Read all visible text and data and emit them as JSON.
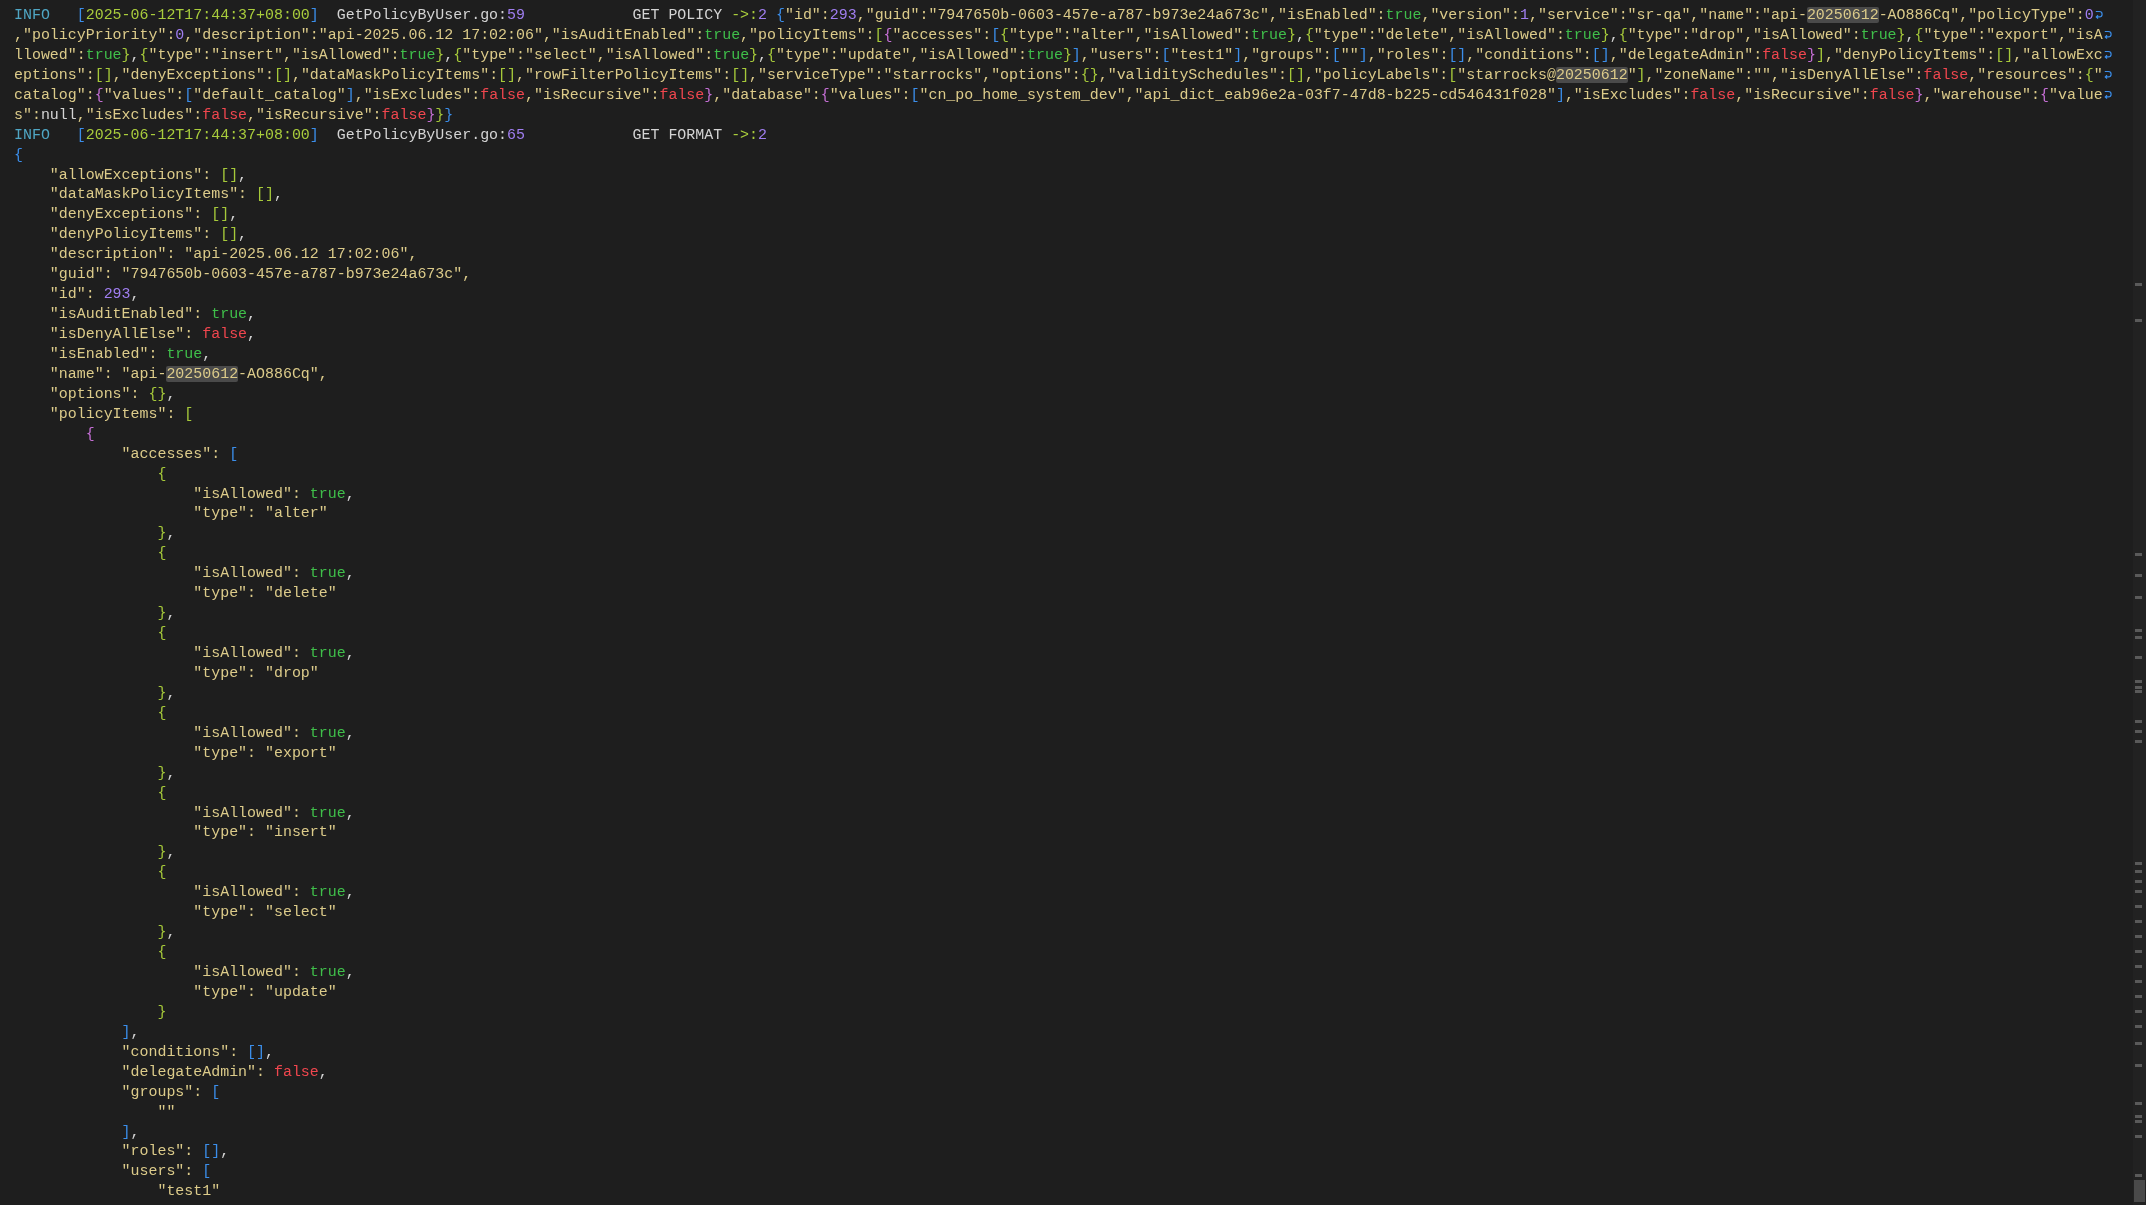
{
  "terminal": {
    "lines": [
      {
        "wrapped": true,
        "tokens": [
          {
            "text": "INFO",
            "kind": "lvl"
          },
          {
            "text": "   [",
            "kind": "b0"
          },
          {
            "text": "2025-06-12T17:44:37+08:00",
            "kind": "ts"
          },
          {
            "text": "]",
            "kind": "b0"
          },
          {
            "text": "  GetPolicyByUser.go:",
            "kind": "p"
          },
          {
            "text": "59",
            "kind": "n"
          },
          {
            "text": "            GET POLICY ",
            "kind": "p"
          },
          {
            "text": "->:",
            "kind": "ts"
          },
          {
            "text": "2",
            "kind": "n"
          },
          {
            "text": " {",
            "kind": "b0"
          },
          {
            "text": "\"id\":",
            "kind": "s"
          },
          {
            "text": "293",
            "kind": "n"
          },
          {
            "text": ",\"guid\":\"7947650b-0603-457e-a787-b973e24a673c\",\"isEnabled\":",
            "kind": "s"
          },
          {
            "text": "true",
            "kind": "t"
          },
          {
            "text": ",\"version\":",
            "kind": "s"
          },
          {
            "text": "1",
            "kind": "n"
          },
          {
            "text": ",\"service\":\"sr-qa\",\"name\":\"api-",
            "kind": "s"
          },
          {
            "text": "20250612",
            "kind": "m"
          },
          {
            "text": "-AO886Cq\",\"policyType\":",
            "kind": "s"
          },
          {
            "text": "0",
            "kind": "n"
          }
        ]
      },
      {
        "wrapped": true,
        "tokens": [
          {
            "text": ",\"policyPriority\":",
            "kind": "s"
          },
          {
            "text": "0",
            "kind": "n"
          },
          {
            "text": ",\"description\":\"api-2025.06.12 17:02:06\",\"isAuditEnabled\":",
            "kind": "s"
          },
          {
            "text": "true",
            "kind": "t"
          },
          {
            "text": ",\"policyItems\":",
            "kind": "s"
          },
          {
            "text": "[",
            "kind": "b1"
          },
          {
            "text": "{",
            "kind": "b2"
          },
          {
            "text": "\"accesses\":",
            "kind": "s"
          },
          {
            "text": "[",
            "kind": "b0"
          },
          {
            "text": "{",
            "kind": "b1"
          },
          {
            "text": "\"type\":\"alter\",\"isAllowed\":",
            "kind": "s"
          },
          {
            "text": "true",
            "kind": "t"
          },
          {
            "text": "}",
            "kind": "b1"
          },
          {
            "text": ",",
            "kind": "p"
          },
          {
            "text": "{",
            "kind": "b1"
          },
          {
            "text": "\"type\":\"delete\",\"isAllowed\":",
            "kind": "s"
          },
          {
            "text": "true",
            "kind": "t"
          },
          {
            "text": "}",
            "kind": "b1"
          },
          {
            "text": ",",
            "kind": "p"
          },
          {
            "text": "{",
            "kind": "b1"
          },
          {
            "text": "\"type\":\"drop\",\"isAllowed\":",
            "kind": "s"
          },
          {
            "text": "true",
            "kind": "t"
          },
          {
            "text": "}",
            "kind": "b1"
          },
          {
            "text": ",",
            "kind": "p"
          },
          {
            "text": "{",
            "kind": "b1"
          },
          {
            "text": "\"type\":\"export\",\"isA",
            "kind": "s"
          }
        ]
      },
      {
        "wrapped": true,
        "tokens": [
          {
            "text": "llowed\":",
            "kind": "s"
          },
          {
            "text": "true",
            "kind": "t"
          },
          {
            "text": "}",
            "kind": "b1"
          },
          {
            "text": ",",
            "kind": "p"
          },
          {
            "text": "{",
            "kind": "b1"
          },
          {
            "text": "\"type\":\"insert\",\"isAllowed\":",
            "kind": "s"
          },
          {
            "text": "true",
            "kind": "t"
          },
          {
            "text": "}",
            "kind": "b1"
          },
          {
            "text": ",",
            "kind": "p"
          },
          {
            "text": "{",
            "kind": "b1"
          },
          {
            "text": "\"type\":\"select\",\"isAllowed\":",
            "kind": "s"
          },
          {
            "text": "true",
            "kind": "t"
          },
          {
            "text": "}",
            "kind": "b1"
          },
          {
            "text": ",",
            "kind": "p"
          },
          {
            "text": "{",
            "kind": "b1"
          },
          {
            "text": "\"type\":\"update\",\"isAllowed\":",
            "kind": "s"
          },
          {
            "text": "true",
            "kind": "t"
          },
          {
            "text": "}",
            "kind": "b1"
          },
          {
            "text": "]",
            "kind": "b0"
          },
          {
            "text": ",\"users\":",
            "kind": "s"
          },
          {
            "text": "[",
            "kind": "b0"
          },
          {
            "text": "\"test1\"",
            "kind": "s"
          },
          {
            "text": "]",
            "kind": "b0"
          },
          {
            "text": ",\"groups\":",
            "kind": "s"
          },
          {
            "text": "[",
            "kind": "b0"
          },
          {
            "text": "\"\"",
            "kind": "s"
          },
          {
            "text": "]",
            "kind": "b0"
          },
          {
            "text": ",\"roles\":",
            "kind": "s"
          },
          {
            "text": "[]",
            "kind": "b0"
          },
          {
            "text": ",\"conditions\":",
            "kind": "s"
          },
          {
            "text": "[]",
            "kind": "b0"
          },
          {
            "text": ",\"delegateAdmin\":",
            "kind": "s"
          },
          {
            "text": "false",
            "kind": "f"
          },
          {
            "text": "}",
            "kind": "b2"
          },
          {
            "text": "]",
            "kind": "b1"
          },
          {
            "text": ",\"denyPolicyItems\":",
            "kind": "s"
          },
          {
            "text": "[]",
            "kind": "b1"
          },
          {
            "text": ",\"allowExc",
            "kind": "s"
          }
        ]
      },
      {
        "wrapped": true,
        "tokens": [
          {
            "text": "eptions\":",
            "kind": "s"
          },
          {
            "text": "[]",
            "kind": "b1"
          },
          {
            "text": ",\"denyExceptions\":",
            "kind": "s"
          },
          {
            "text": "[]",
            "kind": "b1"
          },
          {
            "text": ",\"dataMaskPolicyItems\":",
            "kind": "s"
          },
          {
            "text": "[]",
            "kind": "b1"
          },
          {
            "text": ",\"rowFilterPolicyItems\":",
            "kind": "s"
          },
          {
            "text": "[]",
            "kind": "b1"
          },
          {
            "text": ",\"serviceType\":\"starrocks\",\"options\":",
            "kind": "s"
          },
          {
            "text": "{}",
            "kind": "b1"
          },
          {
            "text": ",\"validitySchedules\":",
            "kind": "s"
          },
          {
            "text": "[]",
            "kind": "b1"
          },
          {
            "text": ",\"policyLabels\":",
            "kind": "s"
          },
          {
            "text": "[",
            "kind": "b1"
          },
          {
            "text": "\"starrocks@",
            "kind": "s"
          },
          {
            "text": "20250612",
            "kind": "m"
          },
          {
            "text": "\"",
            "kind": "s"
          },
          {
            "text": "]",
            "kind": "b1"
          },
          {
            "text": ",\"zoneName\":\"\",\"isDenyAllElse\":",
            "kind": "s"
          },
          {
            "text": "false",
            "kind": "f"
          },
          {
            "text": ",\"resources\":",
            "kind": "s"
          },
          {
            "text": "{",
            "kind": "b1"
          },
          {
            "text": "\"",
            "kind": "s"
          }
        ]
      },
      {
        "wrapped": true,
        "tokens": [
          {
            "text": "catalog\":",
            "kind": "s"
          },
          {
            "text": "{",
            "kind": "b2"
          },
          {
            "text": "\"values\":",
            "kind": "s"
          },
          {
            "text": "[",
            "kind": "b0"
          },
          {
            "text": "\"default_catalog\"",
            "kind": "s"
          },
          {
            "text": "]",
            "kind": "b0"
          },
          {
            "text": ",\"isExcludes\":",
            "kind": "s"
          },
          {
            "text": "false",
            "kind": "f"
          },
          {
            "text": ",\"isRecursive\":",
            "kind": "s"
          },
          {
            "text": "false",
            "kind": "f"
          },
          {
            "text": "}",
            "kind": "b2"
          },
          {
            "text": ",\"database\":",
            "kind": "s"
          },
          {
            "text": "{",
            "kind": "b2"
          },
          {
            "text": "\"values\":",
            "kind": "s"
          },
          {
            "text": "[",
            "kind": "b0"
          },
          {
            "text": "\"cn_po_home_system_dev\",\"api_dict_eab96e2a-03f7-47d8-b225-cd546431f028\"",
            "kind": "s"
          },
          {
            "text": "]",
            "kind": "b0"
          },
          {
            "text": ",\"isExcludes\":",
            "kind": "s"
          },
          {
            "text": "false",
            "kind": "f"
          },
          {
            "text": ",\"isRecursive\":",
            "kind": "s"
          },
          {
            "text": "false",
            "kind": "f"
          },
          {
            "text": "}",
            "kind": "b2"
          },
          {
            "text": ",\"warehouse\":",
            "kind": "s"
          },
          {
            "text": "{",
            "kind": "b2"
          },
          {
            "text": "\"value",
            "kind": "s"
          }
        ]
      },
      {
        "wrapped": false,
        "tokens": [
          {
            "text": "s\":",
            "kind": "s"
          },
          {
            "text": "null",
            "kind": "p"
          },
          {
            "text": ",\"isExcludes\":",
            "kind": "s"
          },
          {
            "text": "false",
            "kind": "f"
          },
          {
            "text": ",\"isRecursive\":",
            "kind": "s"
          },
          {
            "text": "false",
            "kind": "f"
          },
          {
            "text": "}",
            "kind": "b2"
          },
          {
            "text": "}",
            "kind": "b1"
          },
          {
            "text": "}",
            "kind": "b0"
          }
        ]
      },
      {
        "wrapped": false,
        "tokens": [
          {
            "text": "INFO",
            "kind": "lvl"
          },
          {
            "text": "   [",
            "kind": "b0"
          },
          {
            "text": "2025-06-12T17:44:37+08:00",
            "kind": "ts"
          },
          {
            "text": "]",
            "kind": "b0"
          },
          {
            "text": "  GetPolicyByUser.go:",
            "kind": "p"
          },
          {
            "text": "65",
            "kind": "n"
          },
          {
            "text": "            GET FORMAT ",
            "kind": "p"
          },
          {
            "text": "->:",
            "kind": "ts"
          },
          {
            "text": "2",
            "kind": "n"
          }
        ]
      },
      {
        "wrapped": false,
        "tokens": [
          {
            "text": "{",
            "kind": "b0"
          }
        ]
      },
      {
        "wrapped": false,
        "tokens": [
          {
            "text": "    \"allowExceptions\": ",
            "kind": "s"
          },
          {
            "text": "[]",
            "kind": "b1"
          },
          {
            "text": ",",
            "kind": "p"
          }
        ]
      },
      {
        "wrapped": false,
        "tokens": [
          {
            "text": "    \"dataMaskPolicyItems\": ",
            "kind": "s"
          },
          {
            "text": "[]",
            "kind": "b1"
          },
          {
            "text": ",",
            "kind": "p"
          }
        ]
      },
      {
        "wrapped": false,
        "tokens": [
          {
            "text": "    \"denyExceptions\": ",
            "kind": "s"
          },
          {
            "text": "[]",
            "kind": "b1"
          },
          {
            "text": ",",
            "kind": "p"
          }
        ]
      },
      {
        "wrapped": false,
        "tokens": [
          {
            "text": "    \"denyPolicyItems\": ",
            "kind": "s"
          },
          {
            "text": "[]",
            "kind": "b1"
          },
          {
            "text": ",",
            "kind": "p"
          }
        ]
      },
      {
        "wrapped": false,
        "tokens": [
          {
            "text": "    \"description\": \"api-2025.06.12 17:02:06\",",
            "kind": "s"
          }
        ]
      },
      {
        "wrapped": false,
        "tokens": [
          {
            "text": "    \"guid\": \"7947650b-0603-457e-a787-b973e24a673c\",",
            "kind": "s"
          }
        ]
      },
      {
        "wrapped": false,
        "tokens": [
          {
            "text": "    \"id\": ",
            "kind": "s"
          },
          {
            "text": "293",
            "kind": "n"
          },
          {
            "text": ",",
            "kind": "p"
          }
        ]
      },
      {
        "wrapped": false,
        "tokens": [
          {
            "text": "    \"isAuditEnabled\": ",
            "kind": "s"
          },
          {
            "text": "true",
            "kind": "t"
          },
          {
            "text": ",",
            "kind": "p"
          }
        ]
      },
      {
        "wrapped": false,
        "tokens": [
          {
            "text": "    \"isDenyAllElse\": ",
            "kind": "s"
          },
          {
            "text": "false",
            "kind": "f"
          },
          {
            "text": ",",
            "kind": "p"
          }
        ]
      },
      {
        "wrapped": false,
        "tokens": [
          {
            "text": "    \"isEnabled\": ",
            "kind": "s"
          },
          {
            "text": "true",
            "kind": "t"
          },
          {
            "text": ",",
            "kind": "p"
          }
        ]
      },
      {
        "wrapped": false,
        "tokens": [
          {
            "text": "    \"name\": \"api-",
            "kind": "s"
          },
          {
            "text": "20250612",
            "kind": "m"
          },
          {
            "text": "-AO886Cq\",",
            "kind": "s"
          }
        ]
      },
      {
        "wrapped": false,
        "tokens": [
          {
            "text": "    \"options\": ",
            "kind": "s"
          },
          {
            "text": "{}",
            "kind": "b1"
          },
          {
            "text": ",",
            "kind": "p"
          }
        ]
      },
      {
        "wrapped": false,
        "tokens": [
          {
            "text": "    \"policyItems\": ",
            "kind": "s"
          },
          {
            "text": "[",
            "kind": "b1"
          }
        ]
      },
      {
        "wrapped": false,
        "tokens": [
          {
            "text": "        {",
            "kind": "b2"
          }
        ]
      },
      {
        "wrapped": false,
        "tokens": [
          {
            "text": "            \"accesses\": ",
            "kind": "s"
          },
          {
            "text": "[",
            "kind": "b0"
          }
        ]
      },
      {
        "wrapped": false,
        "tokens": [
          {
            "text": "                {",
            "kind": "b1"
          }
        ]
      },
      {
        "wrapped": false,
        "tokens": [
          {
            "text": "                    \"isAllowed\": ",
            "kind": "s"
          },
          {
            "text": "true",
            "kind": "t"
          },
          {
            "text": ",",
            "kind": "p"
          }
        ]
      },
      {
        "wrapped": false,
        "tokens": [
          {
            "text": "                    \"type\": \"alter\"",
            "kind": "s"
          }
        ]
      },
      {
        "wrapped": false,
        "tokens": [
          {
            "text": "                }",
            "kind": "b1"
          },
          {
            "text": ",",
            "kind": "p"
          }
        ]
      },
      {
        "wrapped": false,
        "tokens": [
          {
            "text": "                {",
            "kind": "b1"
          }
        ]
      },
      {
        "wrapped": false,
        "tokens": [
          {
            "text": "                    \"isAllowed\": ",
            "kind": "s"
          },
          {
            "text": "true",
            "kind": "t"
          },
          {
            "text": ",",
            "kind": "p"
          }
        ]
      },
      {
        "wrapped": false,
        "tokens": [
          {
            "text": "                    \"type\": \"delete\"",
            "kind": "s"
          }
        ]
      },
      {
        "wrapped": false,
        "tokens": [
          {
            "text": "                }",
            "kind": "b1"
          },
          {
            "text": ",",
            "kind": "p"
          }
        ]
      },
      {
        "wrapped": false,
        "tokens": [
          {
            "text": "                {",
            "kind": "b1"
          }
        ]
      },
      {
        "wrapped": false,
        "tokens": [
          {
            "text": "                    \"isAllowed\": ",
            "kind": "s"
          },
          {
            "text": "true",
            "kind": "t"
          },
          {
            "text": ",",
            "kind": "p"
          }
        ]
      },
      {
        "wrapped": false,
        "tokens": [
          {
            "text": "                    \"type\": \"drop\"",
            "kind": "s"
          }
        ]
      },
      {
        "wrapped": false,
        "tokens": [
          {
            "text": "                }",
            "kind": "b1"
          },
          {
            "text": ",",
            "kind": "p"
          }
        ]
      },
      {
        "wrapped": false,
        "tokens": [
          {
            "text": "                {",
            "kind": "b1"
          }
        ]
      },
      {
        "wrapped": false,
        "tokens": [
          {
            "text": "                    \"isAllowed\": ",
            "kind": "s"
          },
          {
            "text": "true",
            "kind": "t"
          },
          {
            "text": ",",
            "kind": "p"
          }
        ]
      },
      {
        "wrapped": false,
        "tokens": [
          {
            "text": "                    \"type\": \"export\"",
            "kind": "s"
          }
        ]
      },
      {
        "wrapped": false,
        "tokens": [
          {
            "text": "                }",
            "kind": "b1"
          },
          {
            "text": ",",
            "kind": "p"
          }
        ]
      },
      {
        "wrapped": false,
        "tokens": [
          {
            "text": "                {",
            "kind": "b1"
          }
        ]
      },
      {
        "wrapped": false,
        "tokens": [
          {
            "text": "                    \"isAllowed\": ",
            "kind": "s"
          },
          {
            "text": "true",
            "kind": "t"
          },
          {
            "text": ",",
            "kind": "p"
          }
        ]
      },
      {
        "wrapped": false,
        "tokens": [
          {
            "text": "                    \"type\": \"insert\"",
            "kind": "s"
          }
        ]
      },
      {
        "wrapped": false,
        "tokens": [
          {
            "text": "                }",
            "kind": "b1"
          },
          {
            "text": ",",
            "kind": "p"
          }
        ]
      },
      {
        "wrapped": false,
        "tokens": [
          {
            "text": "                {",
            "kind": "b1"
          }
        ]
      },
      {
        "wrapped": false,
        "tokens": [
          {
            "text": "                    \"isAllowed\": ",
            "kind": "s"
          },
          {
            "text": "true",
            "kind": "t"
          },
          {
            "text": ",",
            "kind": "p"
          }
        ]
      },
      {
        "wrapped": false,
        "tokens": [
          {
            "text": "                    \"type\": \"select\"",
            "kind": "s"
          }
        ]
      },
      {
        "wrapped": false,
        "tokens": [
          {
            "text": "                }",
            "kind": "b1"
          },
          {
            "text": ",",
            "kind": "p"
          }
        ]
      },
      {
        "wrapped": false,
        "tokens": [
          {
            "text": "                {",
            "kind": "b1"
          }
        ]
      },
      {
        "wrapped": false,
        "tokens": [
          {
            "text": "                    \"isAllowed\": ",
            "kind": "s"
          },
          {
            "text": "true",
            "kind": "t"
          },
          {
            "text": ",",
            "kind": "p"
          }
        ]
      },
      {
        "wrapped": false,
        "tokens": [
          {
            "text": "                    \"type\": \"update\"",
            "kind": "s"
          }
        ]
      },
      {
        "wrapped": false,
        "tokens": [
          {
            "text": "                }",
            "kind": "b1"
          }
        ]
      },
      {
        "wrapped": false,
        "tokens": [
          {
            "text": "            ]",
            "kind": "b0"
          },
          {
            "text": ",",
            "kind": "p"
          }
        ]
      },
      {
        "wrapped": false,
        "tokens": [
          {
            "text": "            \"conditions\": ",
            "kind": "s"
          },
          {
            "text": "[]",
            "kind": "b0"
          },
          {
            "text": ",",
            "kind": "p"
          }
        ]
      },
      {
        "wrapped": false,
        "tokens": [
          {
            "text": "            \"delegateAdmin\": ",
            "kind": "s"
          },
          {
            "text": "false",
            "kind": "f"
          },
          {
            "text": ",",
            "kind": "p"
          }
        ]
      },
      {
        "wrapped": false,
        "tokens": [
          {
            "text": "            \"groups\": ",
            "kind": "s"
          },
          {
            "text": "[",
            "kind": "b0"
          }
        ]
      },
      {
        "wrapped": false,
        "tokens": [
          {
            "text": "                \"\"",
            "kind": "s"
          }
        ]
      },
      {
        "wrapped": false,
        "tokens": [
          {
            "text": "            ]",
            "kind": "b0"
          },
          {
            "text": ",",
            "kind": "p"
          }
        ]
      },
      {
        "wrapped": false,
        "tokens": [
          {
            "text": "            \"roles\": ",
            "kind": "s"
          },
          {
            "text": "[]",
            "kind": "b0"
          },
          {
            "text": ",",
            "kind": "p"
          }
        ]
      },
      {
        "wrapped": false,
        "tokens": [
          {
            "text": "            \"users\": ",
            "kind": "s"
          },
          {
            "text": "[",
            "kind": "b0"
          }
        ]
      },
      {
        "wrapped": false,
        "tokens": [
          {
            "text": "                \"test1\"",
            "kind": "s"
          }
        ]
      }
    ]
  }
}
